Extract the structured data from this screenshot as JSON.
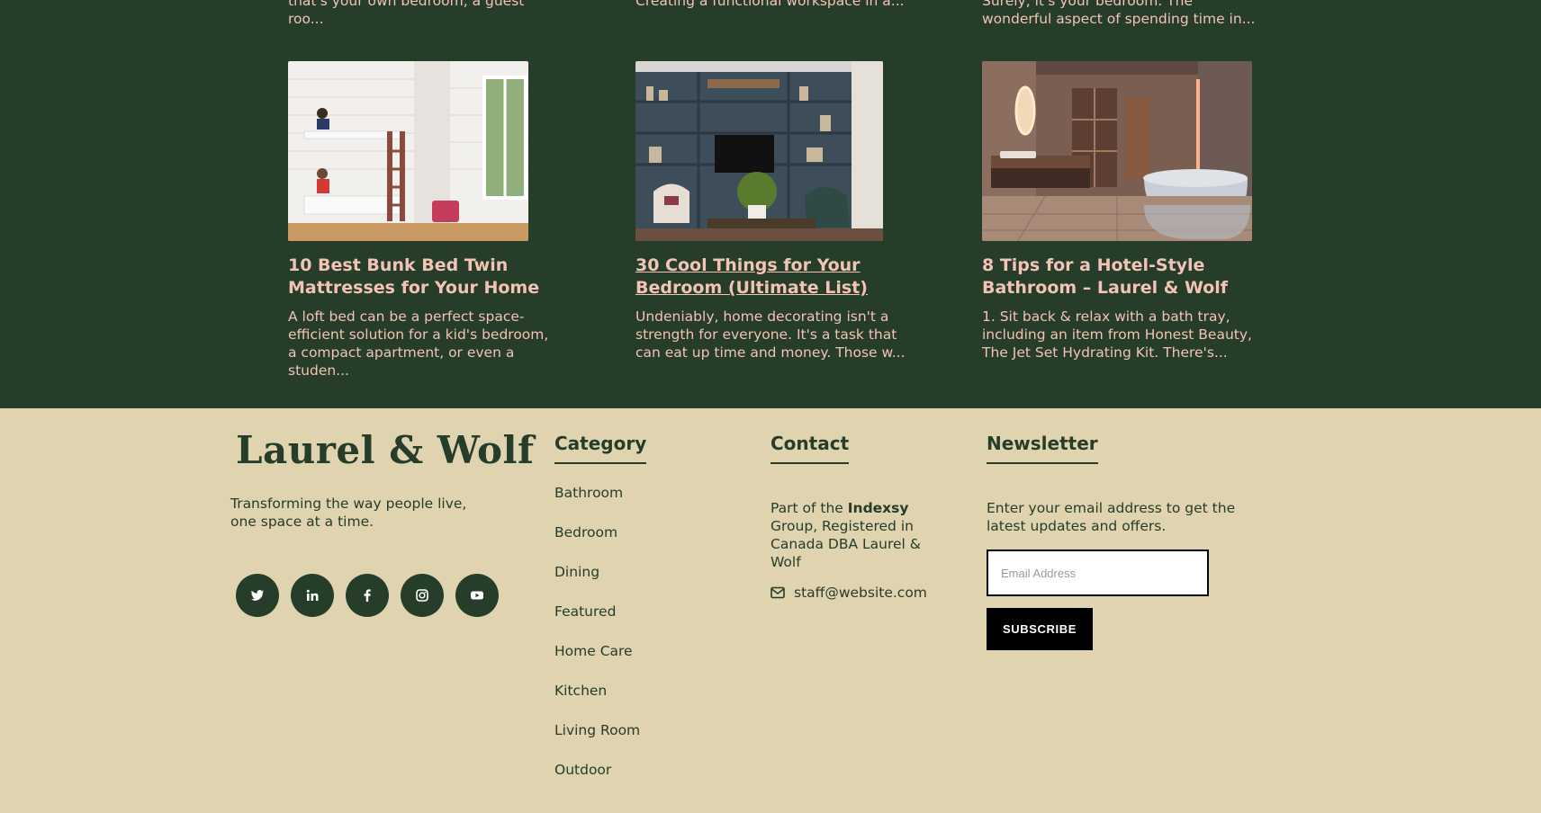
{
  "top_excerpts": [
    "that's your own bedroom, a guest roo...",
    "Creating a functional workspace in a...",
    "Surely, it's your bedroom. The wonderful aspect of spending time in..."
  ],
  "posts": [
    {
      "title": "10 Best Bunk Bed Twin Mattresses for Your Home",
      "excerpt": "A loft bed can be a perfect space-efficient solution for a kid's bedroom, a compact apartment, or even a studen...",
      "image": "bunk-bed-bedroom-photo"
    },
    {
      "title": "30 Cool Things for Your Bedroom (Ultimate List)",
      "excerpt": "Undeniably, home decorating isn't a strength for everyone. It's a task that can eat up time and money. Those w...",
      "image": "living-room-shelves-photo"
    },
    {
      "title": "8 Tips for a Hotel-Style Bathroom – Laurel & Wolf",
      "excerpt": "1. Sit back & relax with a bath tray, including an item from Honest Beauty, The Jet Set Hydrating Kit. There's...",
      "image": "hotel-bathroom-photo"
    }
  ],
  "footer": {
    "brand": "Laurel & Wolf",
    "tagline": "Transforming the way people live, one space at a time.",
    "socials": [
      "twitter-icon",
      "linkedin-icon",
      "facebook-icon",
      "instagram-icon",
      "youtube-icon"
    ],
    "category": {
      "title": "Category",
      "items": [
        "Bathroom",
        "Bedroom",
        "Dining",
        "Featured",
        "Home Care",
        "Kitchen",
        "Living Room",
        "Outdoor"
      ]
    },
    "contact": {
      "title": "Contact",
      "text_before": "Part of the ",
      "company": "Indexsy",
      "text_after": " Group, Registered in Canada DBA Laurel & Wolf",
      "email": "staff@website.com"
    },
    "newsletter": {
      "title": "Newsletter",
      "description": "Enter your email address to get the latest updates and offers.",
      "email_placeholder": "Email Address",
      "subscribe_label": "SUBSCRIBE"
    }
  },
  "colors": {
    "green": "#253d29",
    "beige": "#e0d3b0",
    "pink": "#f3c3b6"
  }
}
